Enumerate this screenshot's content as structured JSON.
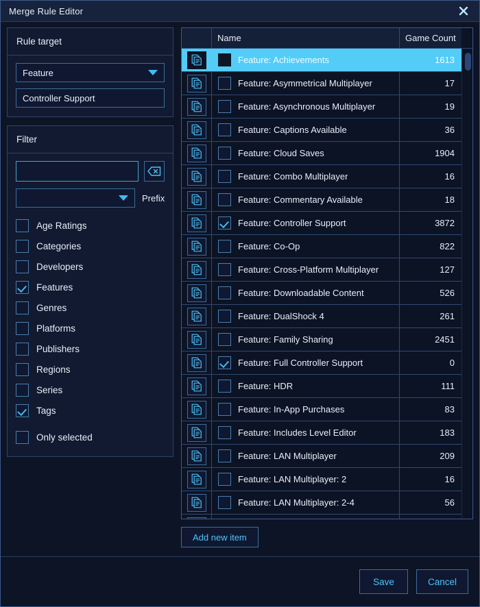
{
  "window": {
    "title": "Merge Rule Editor",
    "close_icon": "close-icon"
  },
  "rule_target": {
    "title": "Rule target",
    "type_value": "Feature",
    "name_value": "Controller Support",
    "caret_icon": "chevron-down-icon"
  },
  "filter": {
    "title": "Filter",
    "search_value": "",
    "search_placeholder": "",
    "clear_icon": "backspace-icon",
    "prefix_value": "",
    "prefix_label": "Prefix",
    "caret_icon": "chevron-down-icon",
    "options": [
      {
        "label": "Age Ratings",
        "checked": false
      },
      {
        "label": "Categories",
        "checked": false
      },
      {
        "label": "Developers",
        "checked": false
      },
      {
        "label": "Features",
        "checked": true
      },
      {
        "label": "Genres",
        "checked": false
      },
      {
        "label": "Platforms",
        "checked": false
      },
      {
        "label": "Publishers",
        "checked": false
      },
      {
        "label": "Regions",
        "checked": false
      },
      {
        "label": "Series",
        "checked": false
      },
      {
        "label": "Tags",
        "checked": true
      }
    ],
    "only_selected": {
      "label": "Only selected",
      "checked": false
    }
  },
  "table": {
    "columns": [
      "",
      "Name",
      "Game Count"
    ],
    "row_icon": "document-icon",
    "rows": [
      {
        "name": "Feature: Achievements",
        "count": "1613",
        "checked": false,
        "selected": true
      },
      {
        "name": "Feature: Asymmetrical Multiplayer",
        "count": "17",
        "checked": false,
        "selected": false
      },
      {
        "name": "Feature: Asynchronous Multiplayer",
        "count": "19",
        "checked": false,
        "selected": false
      },
      {
        "name": "Feature: Captions Available",
        "count": "36",
        "checked": false,
        "selected": false
      },
      {
        "name": "Feature: Cloud Saves",
        "count": "1904",
        "checked": false,
        "selected": false
      },
      {
        "name": "Feature: Combo Multiplayer",
        "count": "16",
        "checked": false,
        "selected": false
      },
      {
        "name": "Feature: Commentary Available",
        "count": "18",
        "checked": false,
        "selected": false
      },
      {
        "name": "Feature: Controller Support",
        "count": "3872",
        "checked": true,
        "selected": false
      },
      {
        "name": "Feature: Co-Op",
        "count": "822",
        "checked": false,
        "selected": false
      },
      {
        "name": "Feature: Cross-Platform Multiplayer",
        "count": "127",
        "checked": false,
        "selected": false
      },
      {
        "name": "Feature: Downloadable Content",
        "count": "526",
        "checked": false,
        "selected": false
      },
      {
        "name": "Feature: DualShock 4",
        "count": "261",
        "checked": false,
        "selected": false
      },
      {
        "name": "Feature: Family Sharing",
        "count": "2451",
        "checked": false,
        "selected": false
      },
      {
        "name": "Feature: Full Controller Support",
        "count": "0",
        "checked": true,
        "selected": false
      },
      {
        "name": "Feature: HDR",
        "count": "111",
        "checked": false,
        "selected": false
      },
      {
        "name": "Feature: In-App Purchases",
        "count": "83",
        "checked": false,
        "selected": false
      },
      {
        "name": "Feature: Includes Level Editor",
        "count": "183",
        "checked": false,
        "selected": false
      },
      {
        "name": "Feature: LAN Multiplayer",
        "count": "209",
        "checked": false,
        "selected": false
      },
      {
        "name": "Feature: LAN Multiplayer: 2",
        "count": "16",
        "checked": false,
        "selected": false
      },
      {
        "name": "Feature: LAN Multiplayer: 2-4",
        "count": "56",
        "checked": false,
        "selected": false
      },
      {
        "name": "",
        "count": "",
        "checked": false,
        "selected": false
      }
    ]
  },
  "actions": {
    "add_new_item": "Add new item",
    "save": "Save",
    "cancel": "Cancel"
  },
  "colors": {
    "accent": "#53cdf7",
    "link": "#4fc3f7",
    "panel_bg": "#111a30",
    "window_bg": "#0d1426",
    "border": "#2e4466"
  }
}
